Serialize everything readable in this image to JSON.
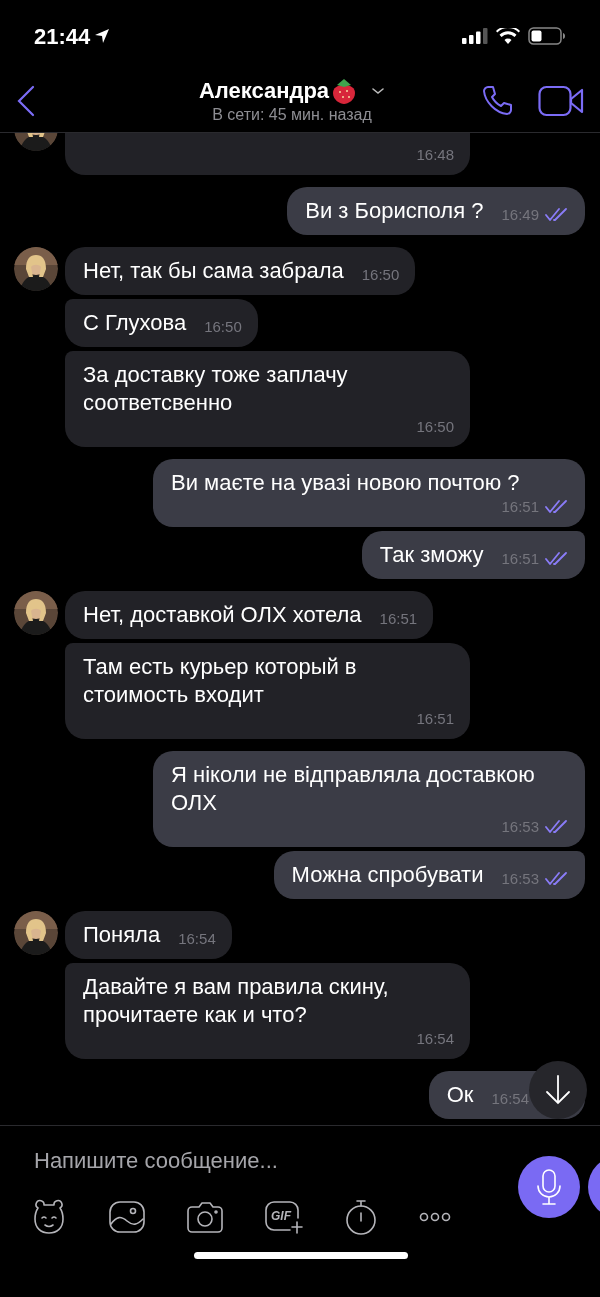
{
  "status_bar": {
    "time": "21:44"
  },
  "header": {
    "name": "Александра",
    "status": "В сети: 45 мин. назад"
  },
  "messages": [
    {
      "kind": "in",
      "time": "16:48",
      "group_start": true
    },
    {
      "kind": "out",
      "text": "Ви з Борисполя ?",
      "time": "16:49",
      "read": true,
      "group_start": true
    },
    {
      "kind": "in",
      "text": "Нет, так бы сама забрала",
      "time": "16:50",
      "group_start": true
    },
    {
      "kind": "in",
      "text": "С Глухова",
      "time": "16:50",
      "group_start": false
    },
    {
      "kind": "in",
      "text": "За доставку тоже заплачу соответсвенно",
      "time": "16:50",
      "group_start": false
    },
    {
      "kind": "out",
      "text": "Ви маєте на увазі новою почтою ?",
      "time": "16:51",
      "read": true,
      "group_start": true
    },
    {
      "kind": "out",
      "text": "Так зможу",
      "time": "16:51",
      "read": true,
      "group_start": false
    },
    {
      "kind": "in",
      "text": "Нет, доставкой ОЛХ хотела",
      "time": "16:51",
      "group_start": true
    },
    {
      "kind": "in",
      "text": "Там есть курьер который в стоимость входит",
      "time": "16:51",
      "group_start": false
    },
    {
      "kind": "out",
      "text": "Я ніколи не відправляла доставкою ОЛХ",
      "time": "16:53",
      "read": true,
      "group_start": true
    },
    {
      "kind": "out",
      "text": "Можна спробувати",
      "time": "16:53",
      "read": true,
      "group_start": false
    },
    {
      "kind": "in",
      "text": "Поняла",
      "time": "16:54",
      "group_start": true
    },
    {
      "kind": "in",
      "text": "Давайте я вам правила скину, прочитаете как и что?",
      "time": "16:54",
      "group_start": false
    },
    {
      "kind": "out",
      "text": "Ок",
      "time": "16:54",
      "group_start": true
    }
  ],
  "composer": {
    "placeholder": "Напишите сообщение...",
    "gif_label": "GIF"
  }
}
